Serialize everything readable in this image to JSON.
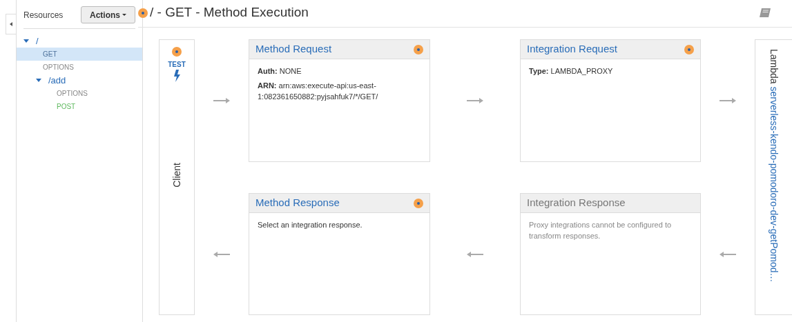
{
  "sidebar": {
    "title": "Resources",
    "actions_button": "Actions",
    "tree": [
      {
        "label": "/",
        "kind": "path",
        "expanded": true,
        "selected": false,
        "children": [
          {
            "label": "GET",
            "kind": "method",
            "color": "#4a6f99",
            "selected": true
          },
          {
            "label": "OPTIONS",
            "kind": "method",
            "color": "#888888",
            "selected": false
          },
          {
            "label": "/add",
            "kind": "path",
            "expanded": true,
            "selected": false,
            "children": [
              {
                "label": "OPTIONS",
                "kind": "method",
                "color": "#888888",
                "selected": false
              },
              {
                "label": "POST",
                "kind": "method",
                "color": "#5cb85c",
                "selected": false
              }
            ]
          }
        ]
      }
    ]
  },
  "page": {
    "title": "/ - GET - Method Execution"
  },
  "client": {
    "test_label": "TEST",
    "label": "Client"
  },
  "boxes": [
    {
      "title": "Method Request",
      "disabled": false,
      "dot": true,
      "lines": [
        "**Auth:** NONE",
        "**ARN:** arn:aws:execute-api:us-east-1:082361650882:pyjsahfuk7/*/GET/"
      ]
    },
    {
      "title": "Integration Request",
      "disabled": false,
      "dot": true,
      "lines": [
        "**Type:** LAMBDA_PROXY"
      ]
    },
    {
      "title": "Method Response",
      "disabled": false,
      "dot": true,
      "lines": [
        "Select an integration response."
      ]
    },
    {
      "title": "Integration Response",
      "disabled": true,
      "dot": false,
      "lines": [
        "Proxy integrations cannot be configured to transform responses."
      ]
    }
  ],
  "lambda": {
    "label": "Lambda",
    "function": "serverless-kendo-pomodoro-dev-getPomod…"
  }
}
